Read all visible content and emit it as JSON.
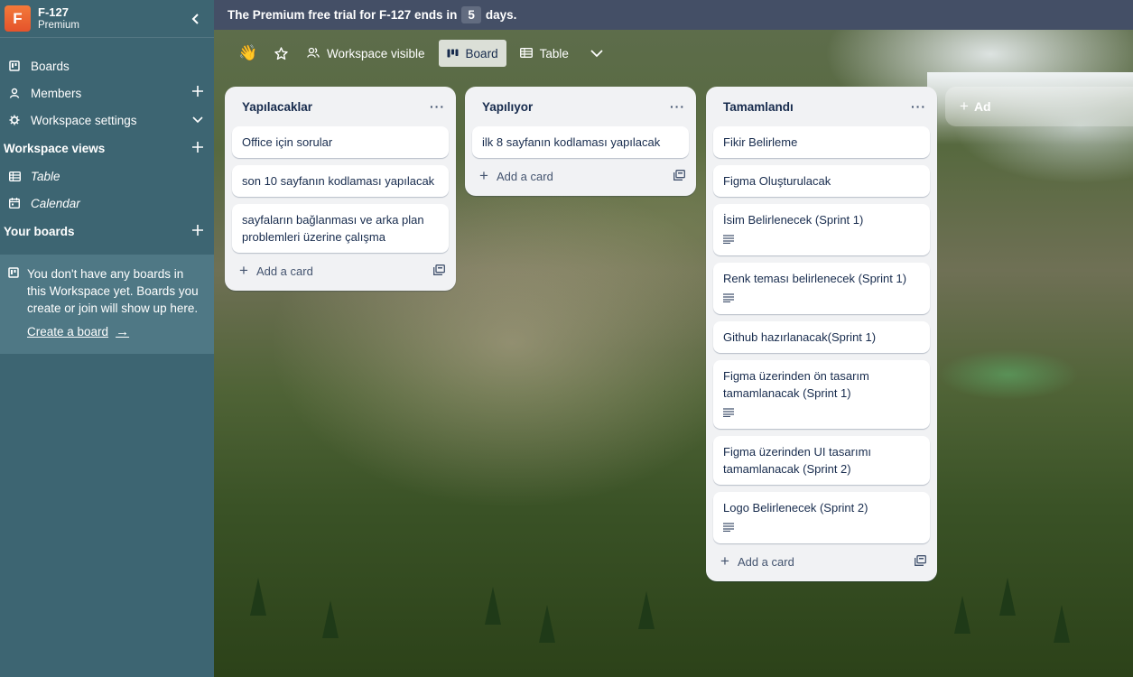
{
  "workspace": {
    "initial": "F",
    "name": "F-127",
    "plan": "Premium"
  },
  "sidebar": {
    "nav": [
      {
        "label": "Boards",
        "icon": "board-icon"
      },
      {
        "label": "Members",
        "icon": "person-icon",
        "tail": "+"
      },
      {
        "label": "Workspace settings",
        "icon": "gear-icon",
        "tail": "chevron-down"
      }
    ],
    "views_heading": "Workspace views",
    "views": [
      {
        "label": "Table",
        "icon": "table-icon"
      },
      {
        "label": "Calendar",
        "icon": "calendar-icon"
      }
    ],
    "boards_heading": "Your boards",
    "empty_text": "You don't have any boards in this Workspace yet. Boards you create or join will show up here.",
    "create_link": "Create a board"
  },
  "banner": {
    "prefix": "The Premium free trial for F-127 ends in",
    "days": "5",
    "suffix": "days."
  },
  "header": {
    "visibility": "Workspace visible",
    "board_view": "Board",
    "table_view": "Table"
  },
  "lists": [
    {
      "title": "Yapılacaklar",
      "cards": [
        {
          "text": "Office için sorular"
        },
        {
          "text": "son 10 sayfanın kodlaması yapılacak"
        },
        {
          "text": "sayfaların bağlanması ve arka plan problemleri üzerine çalışma"
        }
      ],
      "add_label": "Add a card"
    },
    {
      "title": "Yapılıyor",
      "cards": [
        {
          "text": "ilk 8 sayfanın kodlaması yapılacak"
        }
      ],
      "add_label": "Add a card"
    },
    {
      "title": "Tamamlandı",
      "cards": [
        {
          "text": "Fikir Belirleme"
        },
        {
          "text": "Figma Oluşturulacak"
        },
        {
          "text": "İsim Belirlenecek (Sprint 1)",
          "has_desc": true
        },
        {
          "text": "Renk teması belirlenecek (Sprint 1)",
          "has_desc": true
        },
        {
          "text": "Github hazırlanacak(Sprint 1)"
        },
        {
          "text": "Figma üzerinden ön tasarım tamamlanacak (Sprint 1)",
          "has_desc": true
        },
        {
          "text": "Figma üzerinden UI tasarımı tamamlanacak (Sprint 2)"
        },
        {
          "text": "Logo Belirlenecek (Sprint 2)",
          "has_desc": true
        }
      ],
      "add_label": "Add a card"
    }
  ],
  "add_list_label": "Ad"
}
